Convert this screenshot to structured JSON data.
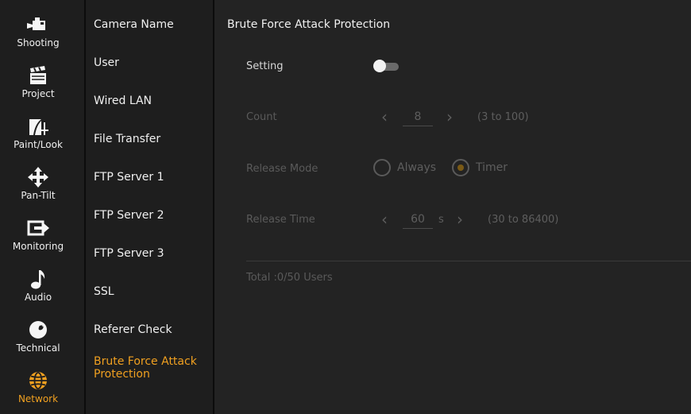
{
  "rail": {
    "items": [
      {
        "label": "Shooting",
        "icon": "camera-icon"
      },
      {
        "label": "Project",
        "icon": "clapperboard-icon"
      },
      {
        "label": "Paint/Look",
        "icon": "paint-look-icon"
      },
      {
        "label": "Pan-Tilt",
        "icon": "pan-tilt-icon"
      },
      {
        "label": "Monitoring",
        "icon": "monitoring-icon"
      },
      {
        "label": "Audio",
        "icon": "music-note-icon"
      },
      {
        "label": "Technical",
        "icon": "wrench-icon"
      },
      {
        "label": "Network",
        "icon": "globe-icon"
      }
    ],
    "active_color": "#f0a020"
  },
  "menu": {
    "items": [
      {
        "label": "Camera Name"
      },
      {
        "label": "User"
      },
      {
        "label": "Wired LAN"
      },
      {
        "label": "File Transfer"
      },
      {
        "label": "FTP Server 1"
      },
      {
        "label": "FTP Server 2"
      },
      {
        "label": "FTP Server 3"
      },
      {
        "label": "SSL"
      },
      {
        "label": "Referer Check"
      },
      {
        "label": "Brute Force Attack Protection"
      }
    ]
  },
  "content": {
    "title": "Brute Force Attack Protection",
    "setting": {
      "label": "Setting",
      "enabled": false
    },
    "count": {
      "label": "Count",
      "value": "8",
      "range": "(3 to 100)"
    },
    "release_mode": {
      "label": "Release Mode",
      "options": [
        "Always",
        "Timer"
      ],
      "selected": "Timer"
    },
    "release_time": {
      "label": "Release Time",
      "value": "60",
      "unit": "s",
      "range": "(30 to 86400)"
    },
    "total": "Total :0/50 Users"
  }
}
